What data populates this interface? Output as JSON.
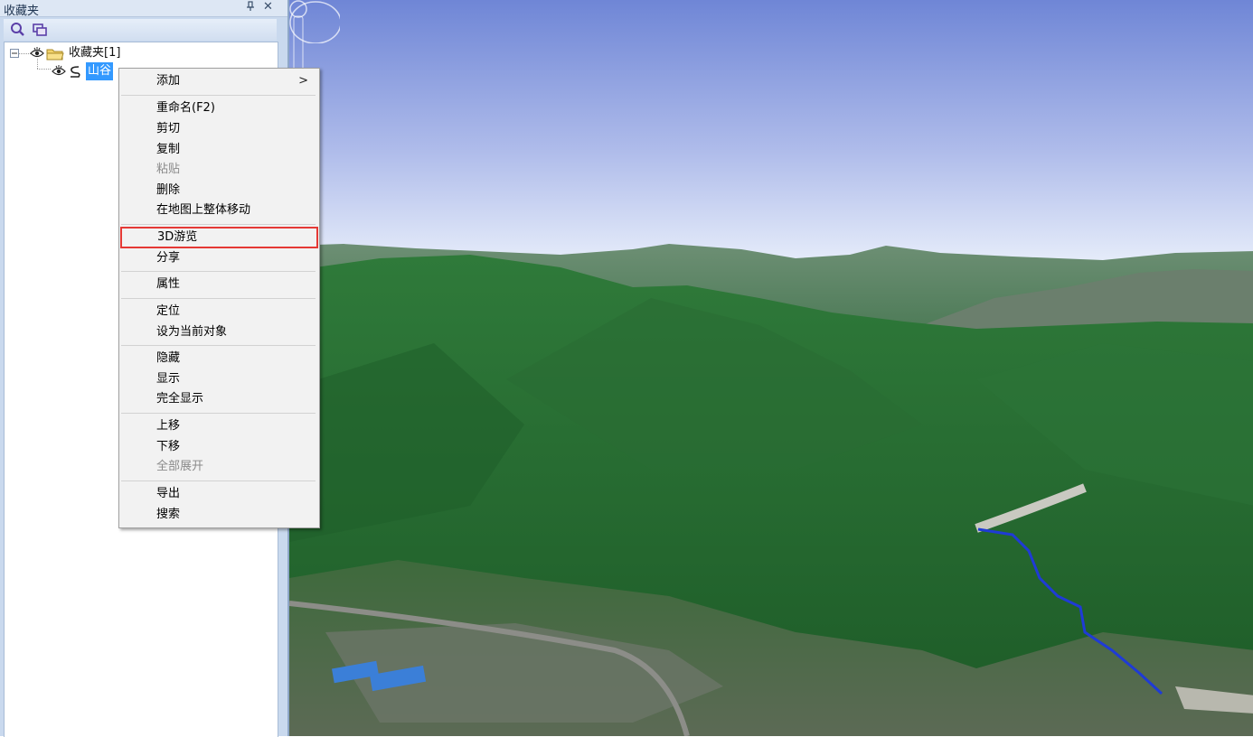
{
  "panel": {
    "title": "收藏夹",
    "pin_icon": "pin-icon",
    "close_glyph": "✕"
  },
  "tree": {
    "root_label": "收藏夹[1]",
    "child_label": "山谷"
  },
  "menu": {
    "add": "添加",
    "add_arrow": ">",
    "rename": "重命名(F2)",
    "cut": "剪切",
    "copy": "复制",
    "paste": "粘贴",
    "delete": "删除",
    "move_on_map": "在地图上整体移动",
    "tour_3d": "3D游览",
    "share": "分享",
    "properties": "属性",
    "locate": "定位",
    "set_current": "设为当前对象",
    "hide": "隐藏",
    "show": "显示",
    "show_all": "完全显示",
    "move_up": "上移",
    "move_down": "下移",
    "expand_all": "全部展开",
    "export": "导出",
    "search": "搜索"
  },
  "colors": {
    "selection": "#3399ff",
    "highlight_box": "#e53935",
    "route_line": "#1f3bd6"
  }
}
